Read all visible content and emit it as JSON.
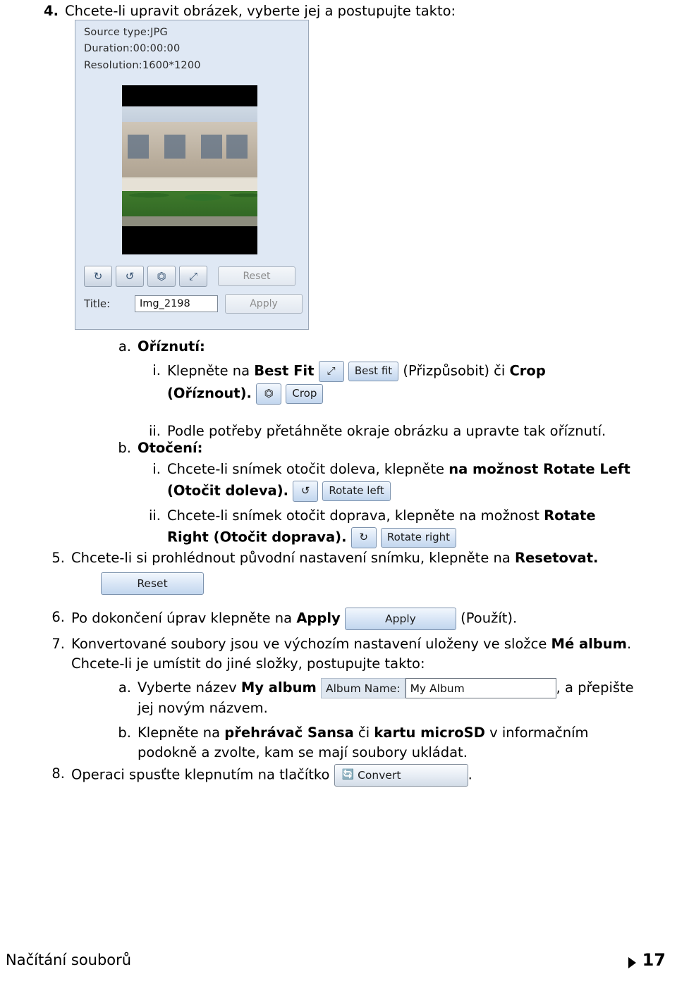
{
  "step4": {
    "number": "4.",
    "text": "Chcete-li upravit obrázek, vyberte jej a postupujte takto:"
  },
  "screenshot": {
    "source_type": "Source type:JPG",
    "duration": "Duration:00:00:00",
    "resolution": "Resolution:1600*1200",
    "toolbar": {
      "rotate_right_icon": "rotate-right-icon",
      "rotate_left_icon": "rotate-left-icon",
      "crop_icon": "crop-icon",
      "best_fit_icon": "best-fit-icon",
      "reset_label": "Reset"
    },
    "title_label": "Title:",
    "title_value": "Img_2198",
    "apply_label": "Apply"
  },
  "items": {
    "a_marker": "a.",
    "a_label": "Oříznutí:",
    "a_i_marker": "i.",
    "a_i_text_1": "Klepněte na",
    "a_i_bold_bestfit": "Best Fit",
    "a_i_chip_bestfit": "Best fit",
    "a_i_text_2": "(Přizpůsobit) či",
    "a_i_bold_crop": "Crop",
    "a_i_bold_crop_cz": "(Oříznout).",
    "a_i_chip_crop": "Crop",
    "a_ii_marker": "ii.",
    "a_ii_text": "Podle potřeby přetáhněte okraje obrázku a upravte tak oříznutí.",
    "b_marker": "b.",
    "b_label": "Otočení:",
    "b_i_marker": "i.",
    "b_i_text": "Chcete-li snímek otočit doleva, klepněte",
    "b_i_bold": "na možnost Rotate Left",
    "b_i_bold2": "(Otočit doleva).",
    "b_i_chip": "Rotate left",
    "b_ii_marker": "ii.",
    "b_ii_text": "Chcete-li snímek otočit doprava, klepněte na možnost",
    "b_ii_bold": "Rotate",
    "b_ii_bold2": "Right (Otočit doprava).",
    "b_ii_chip": "Rotate right",
    "s5_marker": "5.",
    "s5_text": "Chcete-li si prohlédnout původní nastavení snímku, klepněte na",
    "s5_bold": "Resetovat.",
    "s5_chip": "Reset",
    "s6_marker": "6.",
    "s6_text": "Po dokončení úprav klepněte na",
    "s6_bold": "Apply",
    "s6_chip": "Apply",
    "s6_tail": "(Použít).",
    "s7_marker": "7.",
    "s7_text_1": "Konvertované soubory jsou ve výchozím nastavení uloženy ve složce",
    "s7_bold_1": "Mé album",
    "s7_text_2": ".",
    "s7_text_3": "Chcete-li je umístit do jiné složky, postupujte takto:",
    "s7a_marker": "a.",
    "s7a_text_1": "Vyberte název",
    "s7a_bold": "My album",
    "s7a_chip_label": "Album Name:",
    "s7a_chip_value": "My Album",
    "s7a_text_2": ", a přepište",
    "s7a_text_3": "jej novým názvem.",
    "s7b_marker": "b.",
    "s7b_text_1": "Klepněte na",
    "s7b_bold_1": "přehrávač Sansa",
    "s7b_text_2": "či",
    "s7b_bold_2": "kartu microSD",
    "s7b_text_3": "v informačním",
    "s7b_text_4": "podokně a zvolte, kam se mají soubory ukládat.",
    "s8_marker": "8.",
    "s8_text": "Operaci spusťte klepnutím na tlačítko",
    "s8_chip": "Convert",
    "s8_tail": "."
  },
  "footer": {
    "left": "Načítání souborů",
    "page": "17"
  }
}
